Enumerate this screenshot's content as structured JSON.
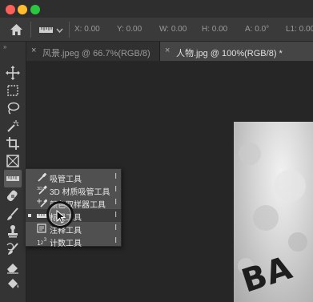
{
  "window": {
    "traffic_lights": {
      "close_color": "#fe5f57",
      "minimize_color": "#febc2e",
      "zoom_color": "#28c840"
    }
  },
  "options_bar": {
    "home_icon": "home-icon",
    "tool_preset_icon": "ruler-icon",
    "fields": [
      "X: 0.00",
      "Y: 0.00",
      "W: 0.00",
      "H: 0.00",
      "A: 0.0°",
      "L1: 0.00"
    ]
  },
  "tabs": [
    {
      "label": "风景.jpeg @ 66.7%(RGB/8)",
      "active": false
    },
    {
      "label": "人物.jpg @ 100%(RGB/8) *",
      "active": true
    }
  ],
  "toolbar": {
    "collapse_label": "»",
    "tools": [
      "move-icon",
      "marquee-icon",
      "lasso-icon",
      "magic-wand-icon",
      "crop-icon",
      "frame-icon",
      "ruler-icon",
      "healing-brush-icon",
      "brush-icon",
      "stamp-icon",
      "history-brush-icon",
      "eraser-icon",
      "paint-bucket-icon"
    ]
  },
  "flyout": {
    "items": [
      {
        "label": "吸管工具",
        "key": "I",
        "icon": "eyedropper-icon",
        "selected": false
      },
      {
        "label": "3D 材质吸管工具",
        "key": "I",
        "icon": "3d-material-eyedropper-icon",
        "selected": false
      },
      {
        "label": "颜色取样器工具",
        "key": "I",
        "icon": "color-sampler-icon",
        "selected": false
      },
      {
        "label": "标尺工具",
        "key": "I",
        "icon": "ruler-icon",
        "selected": true
      },
      {
        "label": "注释工具",
        "key": "I",
        "icon": "note-icon",
        "selected": false
      },
      {
        "label": "计数工具",
        "key": "I",
        "icon": "count-icon",
        "selected": false
      }
    ]
  },
  "canvas": {
    "photo_text": "BA"
  }
}
